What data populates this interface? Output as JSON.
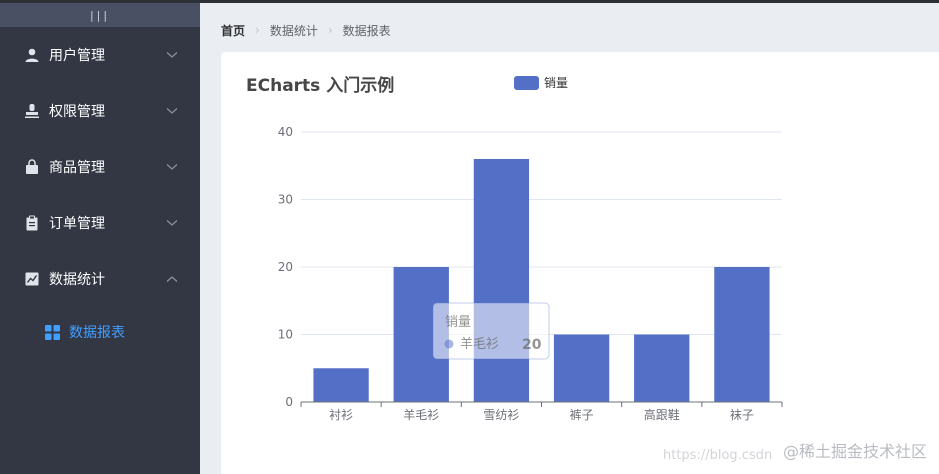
{
  "sidebar": {
    "toggle_label": "|||",
    "items": [
      {
        "label": "用户管理",
        "icon": "user-icon"
      },
      {
        "label": "权限管理",
        "icon": "stamp-icon"
      },
      {
        "label": "商品管理",
        "icon": "bag-icon"
      },
      {
        "label": "订单管理",
        "icon": "clipboard-icon"
      },
      {
        "label": "数据统计",
        "icon": "chart-icon"
      }
    ],
    "sub_item": {
      "label": "数据报表",
      "icon": "grid-icon"
    }
  },
  "breadcrumb": [
    "首页",
    "数据统计",
    "数据报表"
  ],
  "watermark": {
    "text": "@稀土掘金技术社区",
    "url": "https://blog.csdn"
  },
  "colors": {
    "sidebar_bg": "#333744",
    "accent": "#409eff",
    "bar": "#5470c6"
  },
  "chart_data": {
    "type": "bar",
    "title": "ECharts 入门示例",
    "legend": [
      "销量"
    ],
    "legend_placement": "top-center",
    "categories": [
      "衬衫",
      "羊毛衫",
      "雪纺衫",
      "裤子",
      "高跟鞋",
      "袜子"
    ],
    "series": [
      {
        "name": "销量",
        "values": [
          5,
          20,
          36,
          10,
          10,
          20
        ]
      }
    ],
    "yticks": [
      0,
      10,
      20,
      30,
      40
    ],
    "ylim": [
      0,
      40
    ],
    "grid": true,
    "tooltip": {
      "series": "销量",
      "category": "羊毛衫",
      "value": "20"
    }
  }
}
